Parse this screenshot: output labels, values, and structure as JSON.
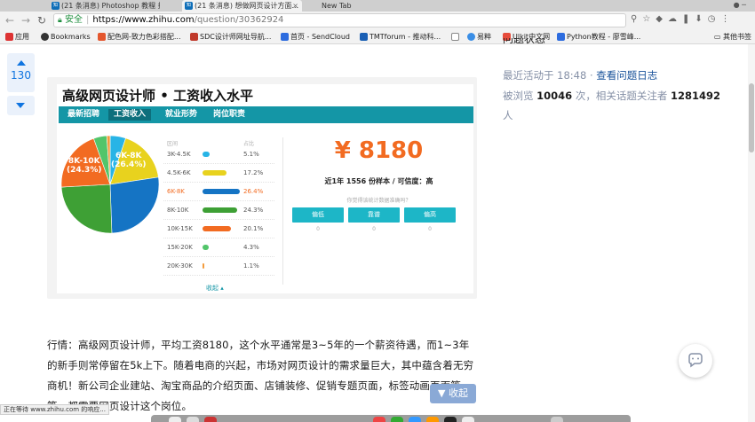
{
  "browser": {
    "tabs": [
      {
        "label": "(21 条消息) Photoshop 教程 推...",
        "active": false
      },
      {
        "label": "(21 条消息) 想做网页设计方面...",
        "active": true
      },
      {
        "label": "New Tab",
        "active": false
      }
    ],
    "url": {
      "secure_label": "安全",
      "host": "https://www.zhihu.com",
      "path": "/question/30362924"
    },
    "bookmarks": [
      {
        "label": "应用",
        "color": "#d33"
      },
      {
        "label": "Bookmarks",
        "color": "#333"
      },
      {
        "label": "配色网-致力色彩搭配...",
        "color": "#e4572e"
      },
      {
        "label": "SDC设计师网址导航...",
        "color": "#c0392b"
      },
      {
        "label": "首页 - SendCloud",
        "color": "#2d6cdf"
      },
      {
        "label": "TMTforum - 推动科...",
        "color": "#1a5fb4"
      },
      {
        "label": "",
        "color": "#888"
      },
      {
        "label": "易粹",
        "color": "#3a8ee6"
      },
      {
        "label": "Ulkit中文网",
        "color": "#e74c3c"
      },
      {
        "label": "Python教程 - 廖雪峰...",
        "color": "#2d6cdf"
      }
    ],
    "bookmarks_other": "其他书签"
  },
  "vote": {
    "count": "130"
  },
  "salary_card": {
    "title": "高级网页设计师 • 工资收入水平",
    "tabs": [
      {
        "label": "最新招聘",
        "active": false
      },
      {
        "label": "工资收入",
        "active": true
      },
      {
        "label": "就业形势",
        "active": false
      },
      {
        "label": "岗位职责",
        "active": false
      }
    ],
    "table_headers": {
      "range": "区间",
      "share": "占比"
    },
    "rows": [
      {
        "range": "3K-4.5K",
        "pct": "5.1%",
        "value": 5.1,
        "color": "#28b4e6",
        "highlight": false
      },
      {
        "range": "4.5K-6K",
        "pct": "17.2%",
        "value": 17.2,
        "color": "#e8d21e",
        "highlight": false
      },
      {
        "range": "6K-8K",
        "pct": "26.4%",
        "value": 26.4,
        "color": "#1574c4",
        "highlight": true
      },
      {
        "range": "8K-10K",
        "pct": "24.3%",
        "value": 24.3,
        "color": "#3ea035",
        "highlight": false
      },
      {
        "range": "10K-15K",
        "pct": "20.1%",
        "value": 20.1,
        "color": "#f26b21",
        "highlight": false
      },
      {
        "range": "15K-20K",
        "pct": "4.3%",
        "value": 4.3,
        "color": "#52c56a",
        "highlight": false
      },
      {
        "range": "20K-30K",
        "pct": "1.1%",
        "value": 1.1,
        "color": "#f39c3d",
        "highlight": false
      }
    ],
    "pie_labels": [
      {
        "range": "8K-10K",
        "pct": "(24.3%)"
      },
      {
        "range": "6K-8K",
        "pct": "(26.4%)"
      }
    ],
    "collapse": "收起 ▴",
    "salary": "¥ 8180",
    "salary_sub": "近1年 1556 份样本 / 可信度：高",
    "feedback_question": "你觉得该统计数据准确吗？",
    "feedback_buttons": [
      {
        "label": "偏低",
        "count": "0"
      },
      {
        "label": "靠谱",
        "count": "0"
      },
      {
        "label": "偏高",
        "count": "0"
      }
    ]
  },
  "chart_data": {
    "type": "pie",
    "categories": [
      "3K-4.5K",
      "4.5K-6K",
      "6K-8K",
      "8K-10K",
      "10K-15K",
      "15K-20K",
      "20K-30K"
    ],
    "values": [
      5.1,
      17.2,
      26.4,
      24.3,
      20.1,
      4.3,
      1.1
    ],
    "title": "高级网页设计师 • 工资收入水平"
  },
  "article": {
    "paragraph": "行情：高级网页设计师，平均工资8180，这个水平通常是3~5年的一个薪资待遇，而1~3年的新手则常停留在5k上下。随着电商的兴起，市场对网页设计的需求量巨大，其中蕴含着无穷商机！新公司企业建站、淘宝商品的介绍页面、店铺装修、促销专题页面，标签动画页面等等，都需要网页设计这个岗位。"
  },
  "sidebar": {
    "title": "问题状态",
    "last_active_prefix": "最近活动于 18:48",
    "log_link": "查看问题日志",
    "views_prefix": "被浏览",
    "views": "10046",
    "views_mid": "次，相关话题关注者",
    "followers": "1281492",
    "followers_suffix": "人"
  },
  "collapse_button": "▼ 收起",
  "status_bar": "正在等待 www.zhihu.com 的响应..."
}
